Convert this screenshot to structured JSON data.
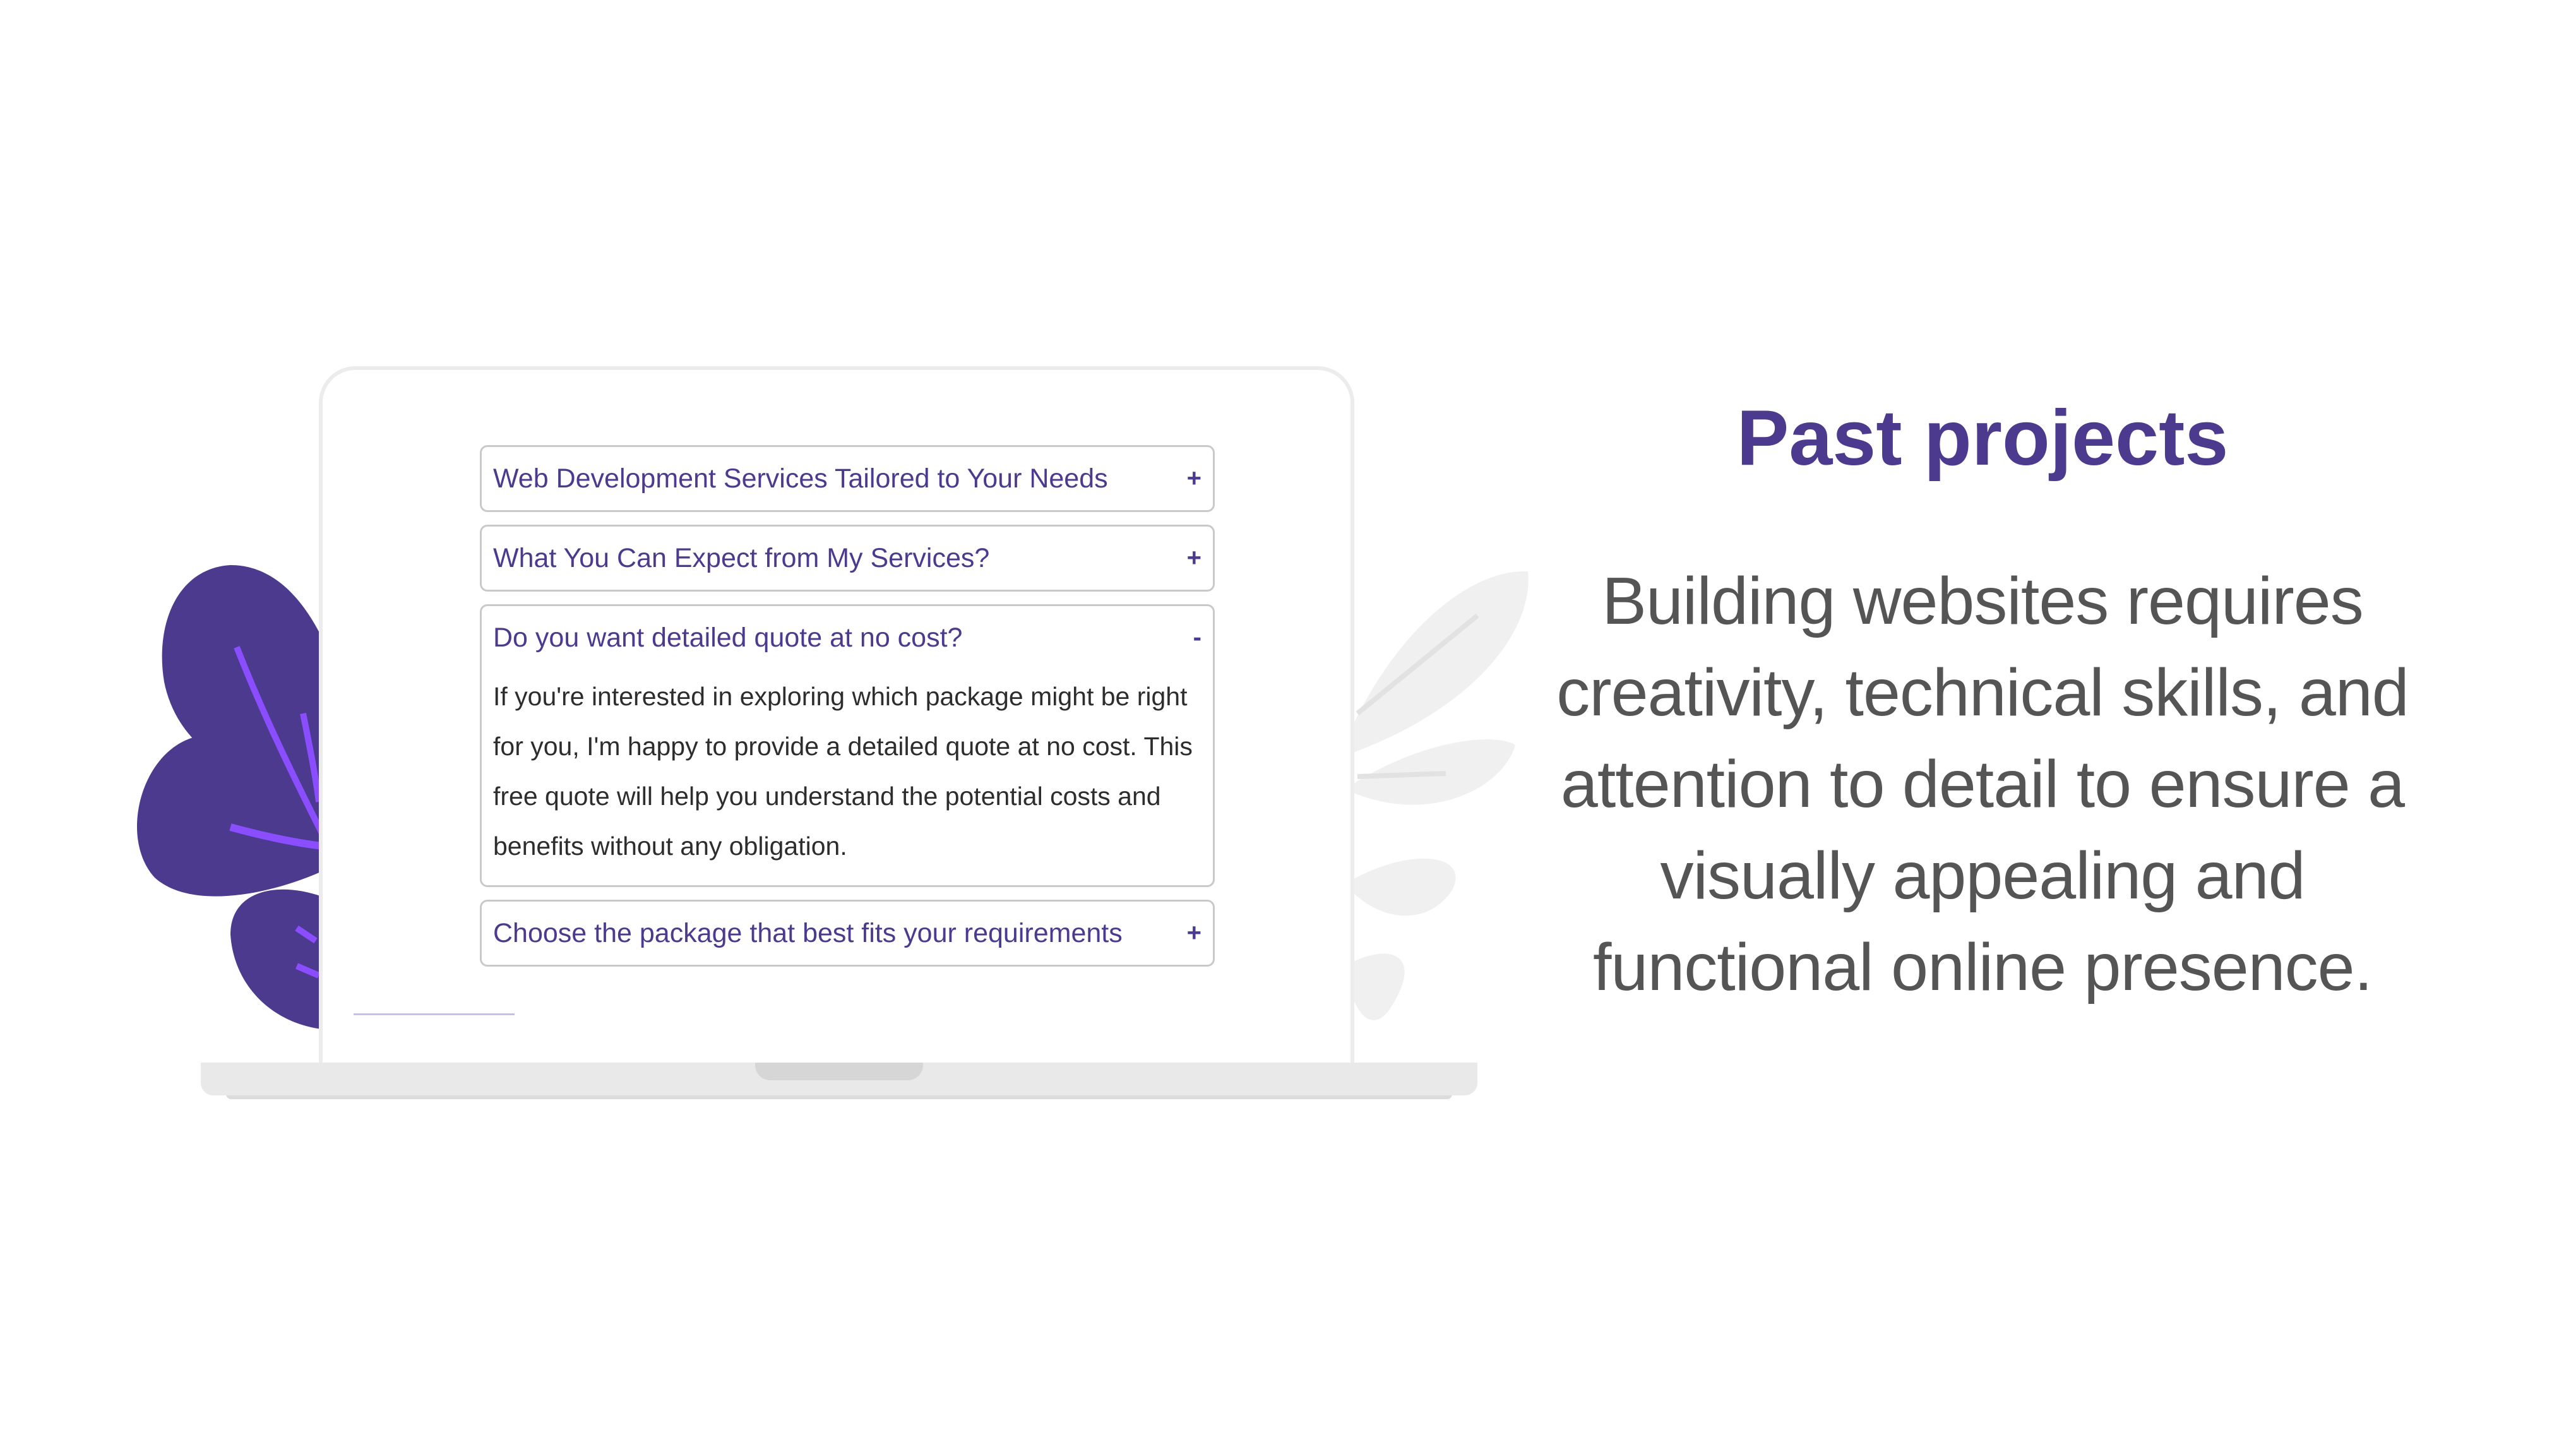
{
  "accordion": {
    "items": [
      {
        "title": "Web Development Services Tailored to Your Needs",
        "sign": "+",
        "expanded": false
      },
      {
        "title": "What You Can Expect from My Services?",
        "sign": "+",
        "expanded": false
      },
      {
        "title": "Do you want detailed quote at no cost?",
        "sign": "-",
        "expanded": true,
        "body": "If you're interested in exploring which package might be right for you, I'm happy to provide a detailed quote at no cost. This free quote will help you understand the potential costs and benefits without any obligation."
      },
      {
        "title": "Choose the package that best fits your requirements",
        "sign": "+",
        "expanded": false
      }
    ]
  },
  "section": {
    "title": "Past projects",
    "description": "Building websites requires creativity, technical skills, and attention to detail to ensure a visually appealing and functional online presence."
  },
  "colors": {
    "accent": "#4b3a8e",
    "leaf_purple": "#4b3a8e",
    "leaf_vein": "#8a4dff",
    "leaf_gray": "#f0f0f0",
    "laptop_frame": "#ececec",
    "body_text": "#555555"
  }
}
